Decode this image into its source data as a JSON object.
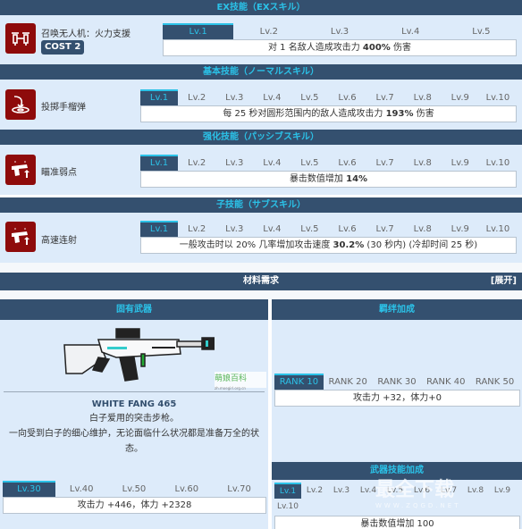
{
  "ex_skill": {
    "header": "EX技能（EXスキル）",
    "name": "召唤无人机：火力支援",
    "cost": "COST 2",
    "icon": "drone-icon",
    "levels": [
      "Lv.1",
      "Lv.2",
      "Lv.3",
      "Lv.4",
      "Lv.5"
    ],
    "active_level": 0,
    "desc_prefix": "对 1 名敌人造成攻击力 ",
    "desc_bold": "400%",
    "desc_suffix": " 伤害"
  },
  "normal_skill": {
    "header": "基本技能（ノーマルスキル）",
    "name": "投掷手榴弹",
    "icon": "grenade-throw-icon",
    "levels": [
      "Lv.1",
      "Lv.2",
      "Lv.3",
      "Lv.4",
      "Lv.5",
      "Lv.6",
      "Lv.7",
      "Lv.8",
      "Lv.9",
      "Lv.10"
    ],
    "active_level": 0,
    "desc_prefix": "每 25 秒对圆形范围内的敌人造成攻击力 ",
    "desc_bold": "193%",
    "desc_suffix": " 伤害"
  },
  "passive_skill": {
    "header": "强化技能（パッシブスキル）",
    "name": "瞄准弱点",
    "icon": "pistol-up-icon",
    "levels": [
      "Lv.1",
      "Lv.2",
      "Lv.3",
      "Lv.4",
      "Lv.5",
      "Lv.6",
      "Lv.7",
      "Lv.8",
      "Lv.9",
      "Lv.10"
    ],
    "active_level": 0,
    "desc_prefix": "暴击数值增加 ",
    "desc_bold": "14%",
    "desc_suffix": ""
  },
  "sub_skill": {
    "header": "子技能（サブスキル）",
    "name": "高速连射",
    "icon": "pistol-up-icon",
    "levels": [
      "Lv.1",
      "Lv.2",
      "Lv.3",
      "Lv.4",
      "Lv.5",
      "Lv.6",
      "Lv.7",
      "Lv.8",
      "Lv.9",
      "Lv.10"
    ],
    "active_level": 0,
    "desc_prefix": "一般攻击时以 20% 几率增加攻击速度 ",
    "desc_bold": "30.2%",
    "desc_suffix": " (30 秒内) (冷却时间 25 秒)"
  },
  "materials": {
    "header": "材料需求",
    "expand_label": "[展开]"
  },
  "weapon": {
    "header": "固有武器",
    "name": "WHITE FANG 465",
    "desc_line1": "白子爱用的突击步枪。",
    "desc_line2": "一向受到白子的细心维护，无论面临什么状况都是准备万全的状",
    "desc_line3": "态。",
    "watermark": "萌娘百科",
    "watermark_url": "zh.moegirl.org.cn",
    "levels": [
      "Lv.30",
      "Lv.40",
      "Lv.50",
      "Lv.60",
      "Lv.70"
    ],
    "active_level": 0,
    "stat_text": "攻击力 +446，体力 +2328"
  },
  "bond": {
    "header": "羁绊加成",
    "ranks": [
      "RANK 10",
      "RANK 20",
      "RANK 30",
      "RANK 40",
      "RANK 50"
    ],
    "active_rank": 0,
    "stat_text": "攻击力 +32，体力+0"
  },
  "weapon_skill": {
    "header": "武器技能加成",
    "levels": [
      "Lv.1",
      "Lv.2",
      "Lv.3",
      "Lv.4",
      "Lv.5",
      "Lv.6",
      "Lv.7",
      "Lv.8",
      "Lv.9",
      "Lv.10"
    ],
    "active_level": 0,
    "stat_text": "暴击数值增加 100"
  },
  "site_watermark": {
    "title": "最全下载",
    "url": "WWW.ZQGD.NET"
  },
  "colors": {
    "header_bg": "#34506f",
    "header_text": "#2bc2e8",
    "panel_bg": "#ddebfa",
    "icon_bg": "#8e0b0b"
  }
}
